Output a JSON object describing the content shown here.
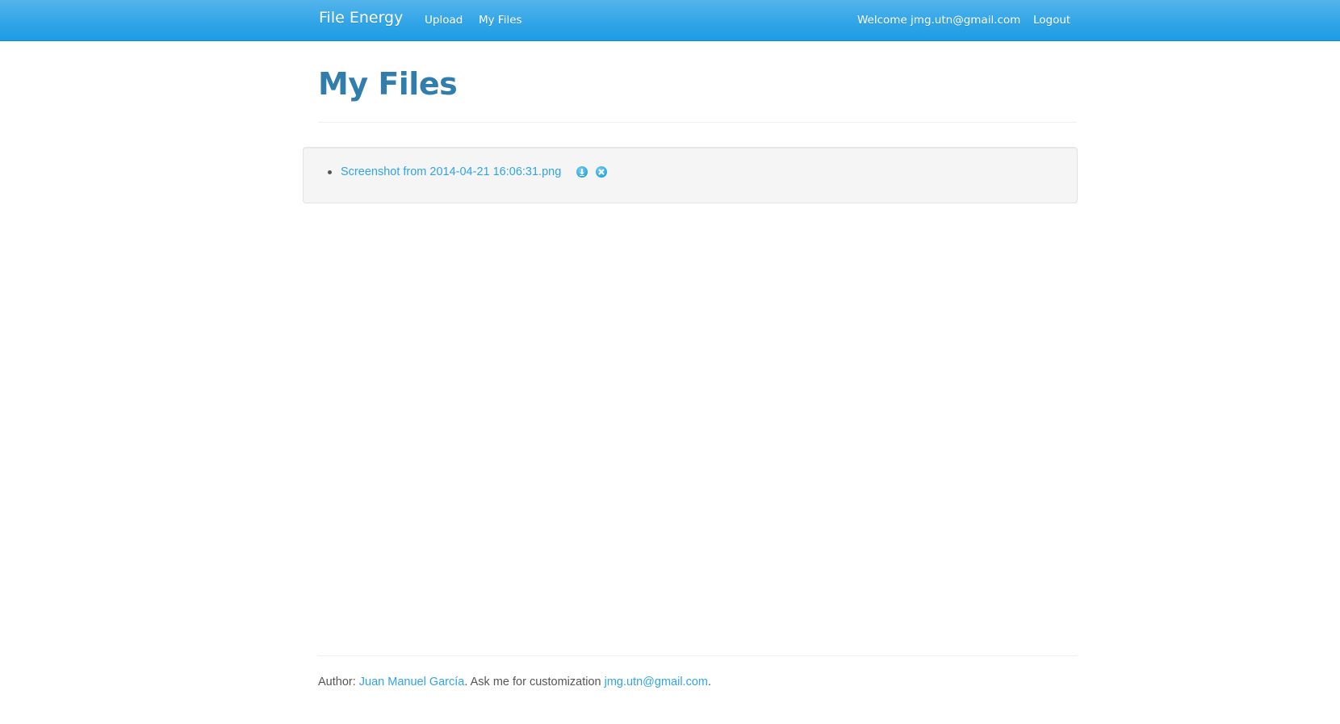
{
  "navbar": {
    "brand": "File Energy",
    "links": [
      {
        "label": "Upload"
      },
      {
        "label": "My Files"
      }
    ],
    "welcome": "Welcome jmg.utn@gmail.com",
    "logout": "Logout"
  },
  "main": {
    "title": "My Files",
    "files": [
      {
        "name": "Screenshot from 2014-04-21 16:06:31.png",
        "download_icon": "download-circle-icon",
        "delete_icon": "delete-circle-icon"
      }
    ]
  },
  "footer": {
    "author_prefix": "Author: ",
    "author_name": "Juan Manuel García",
    "middle_text": ". Ask me for customization ",
    "email": "jmg.utn@gmail.com",
    "suffix": "."
  },
  "colors": {
    "navbar": "#2fa4e7",
    "title": "#317eac",
    "link": "#2fa4e7",
    "well_bg": "#f5f5f5"
  }
}
